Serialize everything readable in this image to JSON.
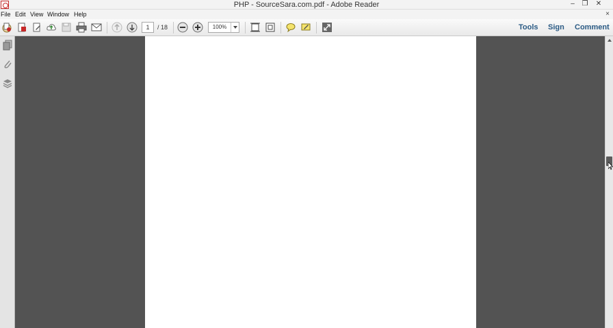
{
  "window": {
    "title": "PHP - SourceSara.com.pdf - Adobe Reader",
    "minimize_glyph": "–",
    "restore_glyph": "❐",
    "close_glyph": "✕"
  },
  "menu": {
    "items": [
      "File",
      "Edit",
      "View",
      "Window",
      "Help"
    ],
    "close_glyph": "×"
  },
  "toolbar": {
    "page_current": "1",
    "page_total": "/ 18",
    "zoom": "100%",
    "tools_label": "Tools",
    "sign_label": "Sign",
    "comment_label": "Comment",
    "icons": [
      "create-pdf-icon",
      "open-pdf-icon",
      "edit-pdf-icon",
      "cloud-upload-icon",
      "save-icon",
      "print-icon",
      "email-icon",
      "previous-page-icon",
      "next-page-icon",
      "zoom-out-icon",
      "zoom-in-icon",
      "fit-width-icon",
      "fit-page-icon",
      "sticky-note-icon",
      "highlight-icon",
      "full-screen-icon"
    ]
  },
  "leftnav": {
    "icons": [
      "page-thumbnails-icon",
      "attachments-icon",
      "layers-icon"
    ]
  },
  "colors": {
    "accent_link": "#2a5a84",
    "workspace": "#535353",
    "page": "#ffffff",
    "brand_red": "#c62828"
  }
}
